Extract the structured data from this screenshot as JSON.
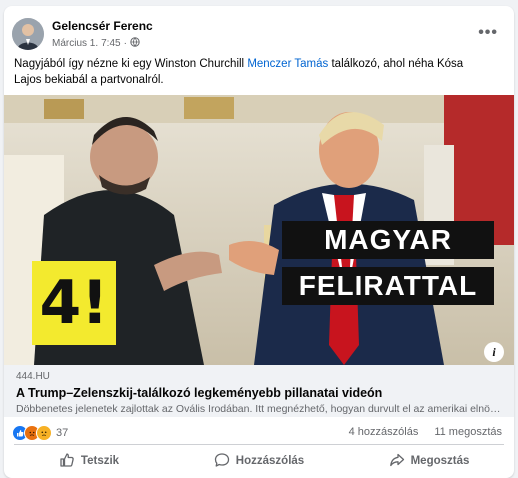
{
  "post": {
    "author": "Gelencsér Ferenc",
    "date": "Március 1.",
    "time": "7:45",
    "dot": "·",
    "text_before": "Nagyjából így nézne ki egy Winston Churchill ",
    "mention": "Menczer Tamás",
    "text_after": " találkozó, ahol néha Kósa Lajos bekiabál a partvonalról.",
    "more_icon": "more-horizontal-icon",
    "audience_icon": "globe-icon"
  },
  "image": {
    "overlay_line1": "MAGYAR",
    "overlay_line2": "FELIRATTAL",
    "logo_text": "4!",
    "info_label": "i"
  },
  "link": {
    "domain": "444.HU",
    "title": "A Trump–Zelenszkij-találkozó legkeményebb pillanatai videón",
    "description": "Döbbenetes jelenetek zajlottak az Ovális Irodában. Itt megnézhető, hogyan durvult el az amerikai elnök és..."
  },
  "stats": {
    "reactions_count": "37",
    "comments": "4 hozzászólás",
    "shares": "11 megosztás",
    "reaction_icons": [
      "like-icon",
      "angry-icon",
      "sad-icon"
    ]
  },
  "actions": {
    "like": "Tetszik",
    "comment": "Hozzászólás",
    "share": "Megosztás"
  },
  "colors": {
    "link_blue": "#0064d1",
    "secondary_text": "#65676b",
    "like_blue": "#1877f2",
    "logo_yellow": "#f3ea2e"
  }
}
